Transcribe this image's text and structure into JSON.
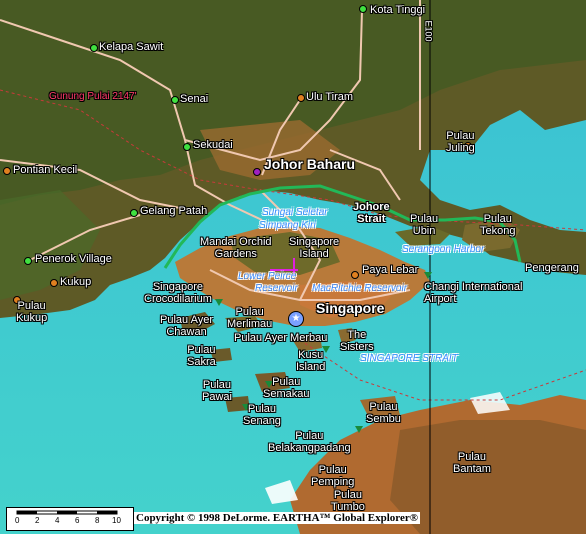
{
  "map": {
    "cities": {
      "johor_baharu": "Johor Baharu",
      "singapore": "Singapore"
    },
    "places": {
      "kota_tinggi": "Kota Tinggi",
      "kelapa_sawit": "Kelapa Sawit",
      "senai": "Senai",
      "ulu_tiram": "Ulu Tiram",
      "sekudai": "Sekudai",
      "pontian_kecil": "Pontian Kecil",
      "gelang_patah": "Gelang Patah",
      "penerok_village": "Penerok Village",
      "kukup": "Kukup",
      "pulau_kukup": "Pulau\nKukup",
      "pulau_juling": "Pulau\nJuling",
      "pulau_ubin": "Pulau\nUbin",
      "pulau_tekong": "Pulau\nTekong",
      "pengerang": "Pengerang",
      "paya_lebar": "Paya Lebar",
      "changi_airport": "Changi International\nAirport",
      "mandai_orchid": "Mandai Orchid\nGardens",
      "singapore_island": "Singapore\nIsland",
      "singapore_crocodilarium": "Singapore\nCrocodilarium",
      "pulau_ayer_chawan": "Pulau Ayer\nChawan",
      "pulau_merlimau": "Pulau\nMerlimau",
      "pulau_ayer_merbau": "Pulau Ayer Merbau",
      "pulau_sakra": "Pulau\nSakra",
      "kusu_island": "Kusu\nIsland",
      "the_sisters": "The\nSisters",
      "pulau_pawai": "Pulau\nPawai",
      "pulau_semakau": "Pulau\nSemakau",
      "pulau_senang": "Pulau\nSenang",
      "pulau_sembu": "Pulau\nSembu",
      "pulau_belakangpadang": "Pulau\nBelakangpadang",
      "pulau_pemping": "Pulau\nPemping",
      "pulau_tumbo": "Pulau\nTumbo",
      "pulau_bantam": "Pulau\nBantam",
      "johore_strait": "Johore\nStrait"
    },
    "water": {
      "sungai_seletar": "Sungai Seletar",
      "simpang_kiri": "Simpang Kiri",
      "lower_peirce": "Lower Peirce",
      "reservoir": "Reservoir",
      "macritchie": "MacRitchie Reservoir",
      "serangoon_harbor": "Serangoon Harbor",
      "singapore_strait": "SINGAPORE STRAIT"
    },
    "peak": "Gunung Pulai 2147'",
    "road_label": "E100",
    "scale": {
      "ticks": [
        "0",
        "2",
        "4",
        "6",
        "8",
        "10"
      ]
    },
    "copyright": "Copyright © 1998 DeLorme.  EARTHA™ Global Explorer®"
  },
  "colors": {
    "water": "#3ec8d8",
    "land": "#6b5a2a",
    "route": "#22b858",
    "road": "#f0c8b0",
    "highlight": "#e020e0"
  }
}
